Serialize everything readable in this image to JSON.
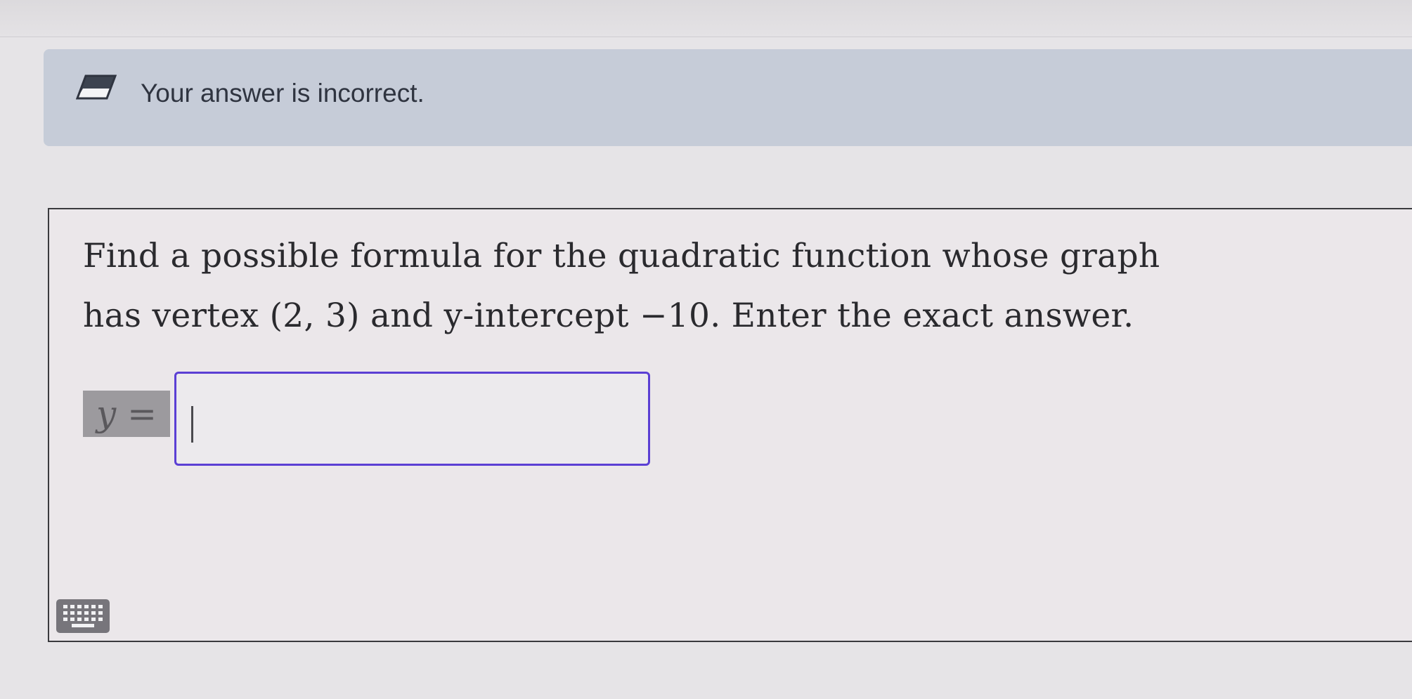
{
  "feedback": {
    "message": "Your answer is incorrect.",
    "icon": "eraser-icon",
    "background_color": "#c6ccd8"
  },
  "question": {
    "line1": "Find a possible formula for the quadratic function whose graph",
    "line2": "has vertex (2, 3) and y-intercept −10. Enter the exact answer."
  },
  "answer": {
    "label": "y =",
    "value": "",
    "border_color": "#5b3fd4"
  },
  "keyboard_button": {
    "icon": "keyboard-icon"
  }
}
